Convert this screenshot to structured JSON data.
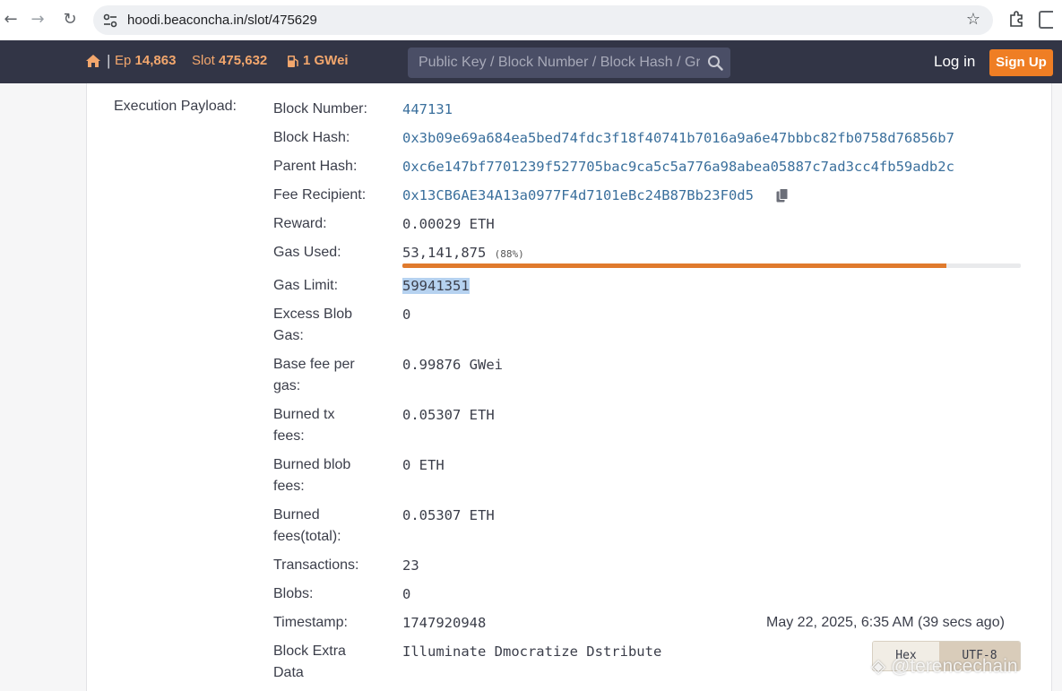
{
  "browser": {
    "url": "hoodi.beaconcha.in/slot/475629"
  },
  "navbar": {
    "epoch_label": "Ep",
    "epoch_value": "14,863",
    "slot_label": "Slot",
    "slot_value": "475,632",
    "gas_value": "1 GWei",
    "search_placeholder": "Public Key / Block Number / Block Hash / Graffiti",
    "login_label": "Log in",
    "signup_label": "Sign Up",
    "separator": "|"
  },
  "payload": {
    "section_label": "Execution Payload:",
    "fields": {
      "block_number": {
        "label": "Block Number:",
        "value": "447131"
      },
      "block_hash": {
        "label": "Block Hash:",
        "value": "0x3b09e69a684ea5bed74fdc3f18f40741b7016a9a6e47bbbc82fb0758d76856b7"
      },
      "parent_hash": {
        "label": "Parent Hash:",
        "value": "0xc6e147bf7701239f527705bac9ca5c5a776a98abea05887c7ad3cc4fb59adb2c"
      },
      "fee_recipient": {
        "label": "Fee Recipient:",
        "value": "0x13CB6AE34A13a0977F4d7101eBc24B87Bb23F0d5"
      },
      "reward": {
        "label": "Reward:",
        "value": "0.00029 ETH"
      },
      "gas_used": {
        "label": "Gas Used:",
        "value": "53,141,875",
        "percent_text": "(88%)",
        "percent": 88
      },
      "gas_limit": {
        "label": "Gas Limit:",
        "value": "59941351"
      },
      "excess_blob_gas": {
        "label": "Excess Blob Gas:",
        "value": "0"
      },
      "base_fee": {
        "label": "Base fee per gas:",
        "value": "0.99876 GWei"
      },
      "burned_tx_fees": {
        "label": "Burned tx fees:",
        "value": "0.05307 ETH"
      },
      "burned_blob_fees": {
        "label": "Burned blob fees:",
        "value": "0 ETH"
      },
      "burned_fees_total": {
        "label": "Burned fees(total):",
        "value": "0.05307 ETH"
      },
      "transactions": {
        "label": "Transactions:",
        "value": "23"
      },
      "blobs": {
        "label": "Blobs:",
        "value": "0"
      },
      "timestamp": {
        "label": "Timestamp:",
        "value": "1747920948",
        "human": "May 22, 2025, 6:35 AM (39 secs ago)"
      },
      "extra_data": {
        "label": "Block Extra Data",
        "value": "Illuminate Dmocratize Dstribute"
      }
    },
    "encoding_toggle": {
      "hex_label": "Hex",
      "utf8_label": "UTF-8",
      "selected": "UTF-8"
    }
  },
  "watermark": "@terencechain",
  "colors": {
    "navbar_bg": "#323546",
    "accent_orange": "#ef7e24",
    "link_blue": "#3a6f9c",
    "gas_bar": "#e07a2d"
  }
}
